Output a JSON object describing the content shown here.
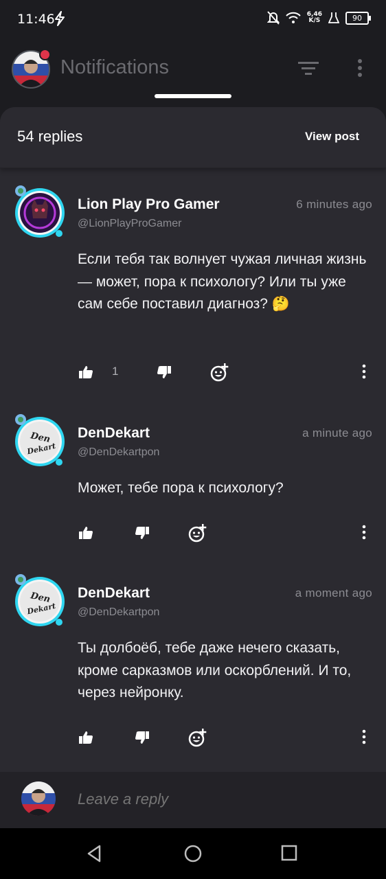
{
  "status_bar": {
    "time": "11:46",
    "net_speed_value": "6,46",
    "net_speed_unit": "K/S",
    "battery": "90"
  },
  "header": {
    "title": "Notifications"
  },
  "sheet": {
    "replies_count": "54 replies",
    "view_post": "View post"
  },
  "comments": [
    {
      "name": "Lion Play Pro Gamer",
      "handle": "@LionPlayProGamer",
      "time": "6 minutes ago",
      "text": "Если тебя так волнует чужая личная жизнь — может, пора к психологу? Или ты уже сам себе поставил диагноз? 🤔",
      "likes": "1"
    },
    {
      "name": "DenDekart",
      "handle": "@DenDekartpon",
      "time": "a minute ago",
      "text": "Может, тебе пора к психологу?",
      "likes": ""
    },
    {
      "name": "DenDekart",
      "handle": "@DenDekartpon",
      "time": "a moment ago",
      "text": "Ты долбоёб, тебе даже нечего сказать, кроме сарказмов или оскорблений. И то, через нейронку.",
      "likes": ""
    }
  ],
  "avatar_labels": {
    "den": "Den",
    "dekart": "Dekart"
  },
  "reply_bar": {
    "placeholder": "Leave a reply"
  },
  "colors": {
    "background": "#1c1c20",
    "sheet": "#2b2a30",
    "avatar_ring": "#2fd6f0",
    "muted_text": "#8c8c92"
  }
}
